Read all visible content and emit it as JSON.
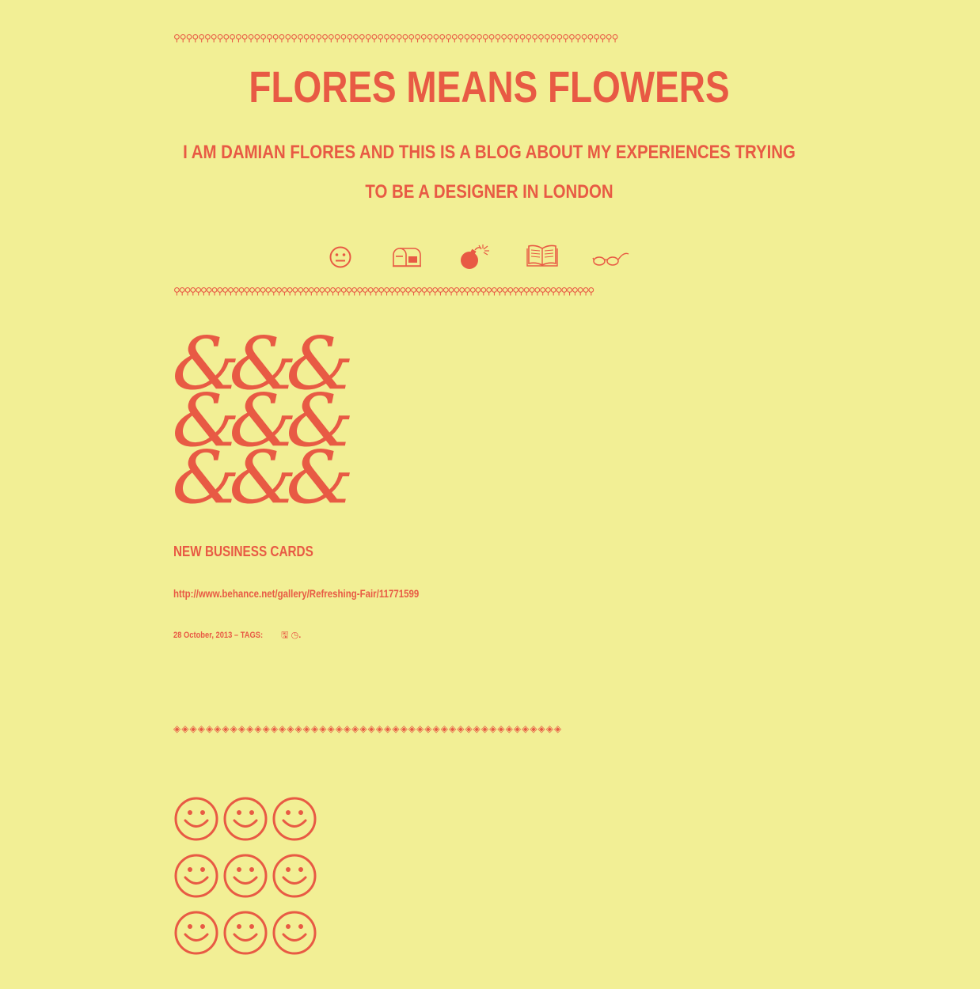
{
  "site": {
    "title": "FLORES MEANS FLOWERS",
    "subtitle": "I AM DAMIAN FLORES AND THIS IS A BLOG ABOUT MY EXPERIENCES TRYING TO BE A DESIGNER IN LONDON"
  },
  "borders": {
    "top_glyph": "⚲",
    "mid_glyph": "⚲",
    "sep_glyph": "◈"
  },
  "nav": {
    "items": [
      {
        "icon": "neutral-face-icon"
      },
      {
        "icon": "mailbox-icon"
      },
      {
        "icon": "bomb-icon"
      },
      {
        "icon": "open-book-icon"
      },
      {
        "icon": "eyeglasses-icon"
      }
    ]
  },
  "post": {
    "image_glyph": "&",
    "title": "NEW BUSINESS CARDS",
    "link": "http://www.behance.net/gallery/Refreshing-Fair/11771599",
    "date": "28 October, 2013",
    "tags_label": "TAGS:",
    "tags": [
      {
        "icon": "floppy-disk-icon",
        "glyph": "🖫"
      },
      {
        "icon": "clock-icon",
        "glyph": "◷"
      }
    ],
    "tags_end": "."
  },
  "colors": {
    "background": "#f2ef95",
    "accent": "#e85a44"
  },
  "next_post": {
    "image_icon": "smiley-icon"
  }
}
